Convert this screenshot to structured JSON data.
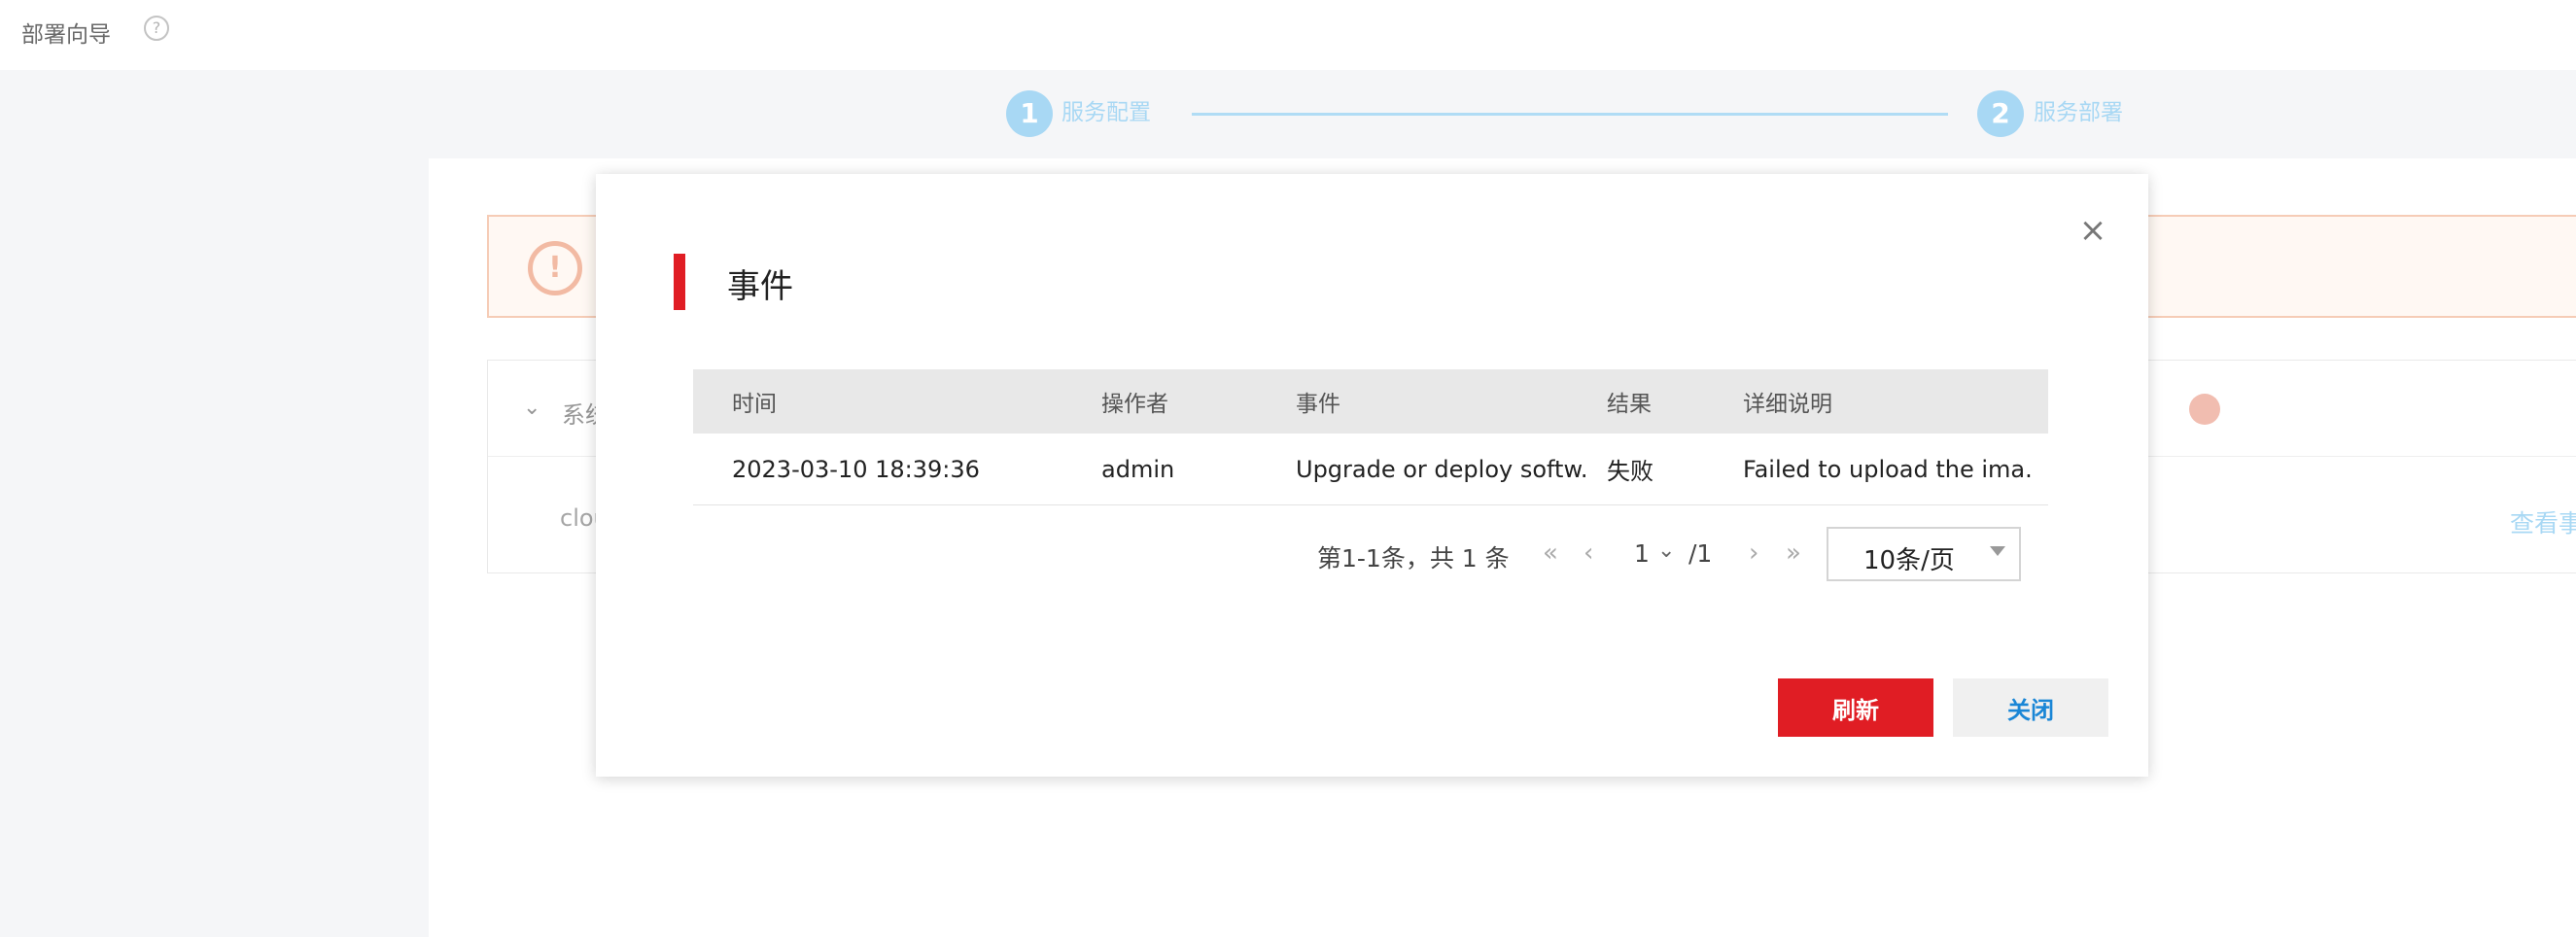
{
  "header": {
    "title": "部署向导",
    "help_icon": "question-circle-icon"
  },
  "stepper": {
    "steps": [
      {
        "number": "1",
        "label": "服务配置"
      },
      {
        "number": "2",
        "label": "服务部署"
      }
    ]
  },
  "background": {
    "alert_icon": "exclamation-circle-icon",
    "section_title": "系统",
    "row_text": "clou",
    "view_events": "查看事件"
  },
  "dialog": {
    "title": "事件",
    "close_icon": "close-icon",
    "table": {
      "columns": [
        "时间",
        "操作者",
        "事件",
        "结果",
        "详细说明"
      ],
      "rows": [
        [
          "2023-03-10 18:39:36",
          "admin",
          "Upgrade or deploy softw...",
          "失败",
          "Failed to upload the ima..."
        ]
      ]
    },
    "pagination": {
      "summary": "第1-1条，共 1 条",
      "current_page": "1",
      "total_pages": "/1",
      "page_size": "10条/页"
    },
    "buttons": {
      "refresh": "刷新",
      "close": "关闭"
    }
  },
  "colors": {
    "accent_red": "#e01d24",
    "step_blue": "#9dd3f3",
    "link_blue": "#1a86d6"
  }
}
